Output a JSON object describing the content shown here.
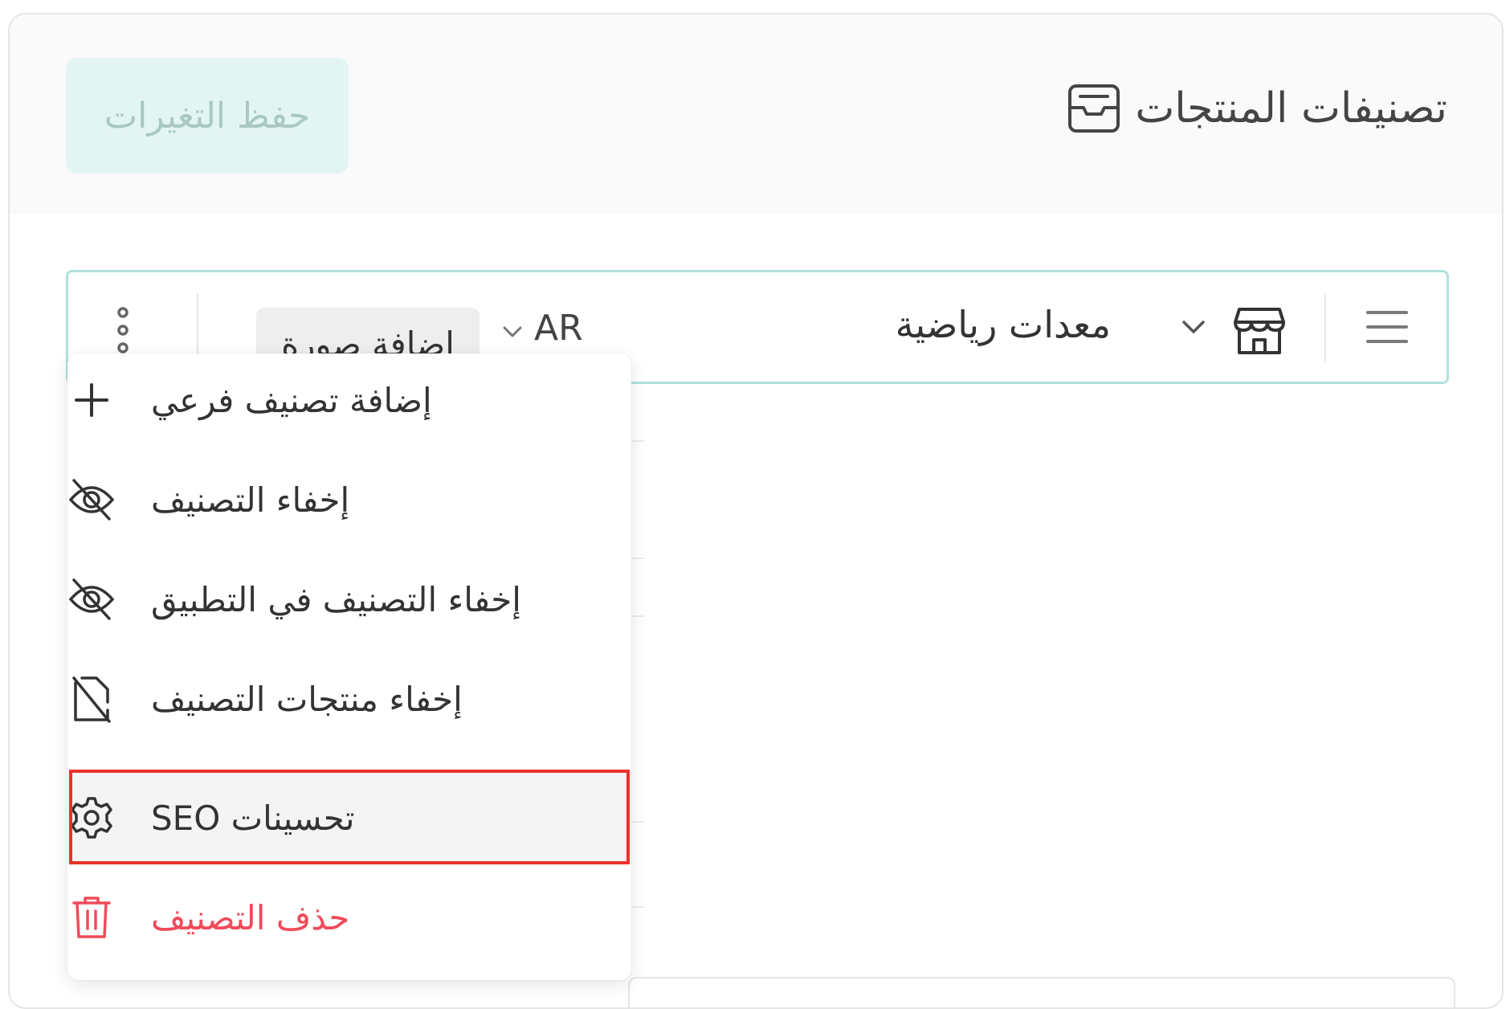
{
  "header": {
    "title": "تصنيفات المنتجات",
    "title_icon": "inbox-tray-icon",
    "save_button_label": "حفظ التغيرات"
  },
  "category_row": {
    "name": "معدات رياضية",
    "store_icon": "store-icon",
    "language": "AR",
    "add_image_label": "إضافة صورة",
    "menu_icon": "hamburger-menu-icon",
    "more_icon": "vertical-dots-icon"
  },
  "dropdown_menu": {
    "items": [
      {
        "label": "إضافة تصنيف فرعي",
        "icon": "plus-icon"
      },
      {
        "label": "إخفاء التصنيف",
        "icon": "eye-off-icon"
      },
      {
        "label": "إخفاء التصنيف في التطبيق",
        "icon": "eye-off-icon"
      },
      {
        "label": "إخفاء منتجات التصنيف",
        "icon": "file-off-icon"
      },
      {
        "label": "تحسينات SEO",
        "icon": "gear-icon",
        "highlighted": true
      },
      {
        "label": "حذف التصنيف",
        "icon": "trash-icon",
        "danger": true
      }
    ]
  },
  "colors": {
    "accent_border": "#aee3dc",
    "save_button_bg": "#e3f5f2",
    "save_button_text": "#a9c8c3",
    "danger": "#ef4b5a",
    "highlight_outline": "#e8332a"
  }
}
